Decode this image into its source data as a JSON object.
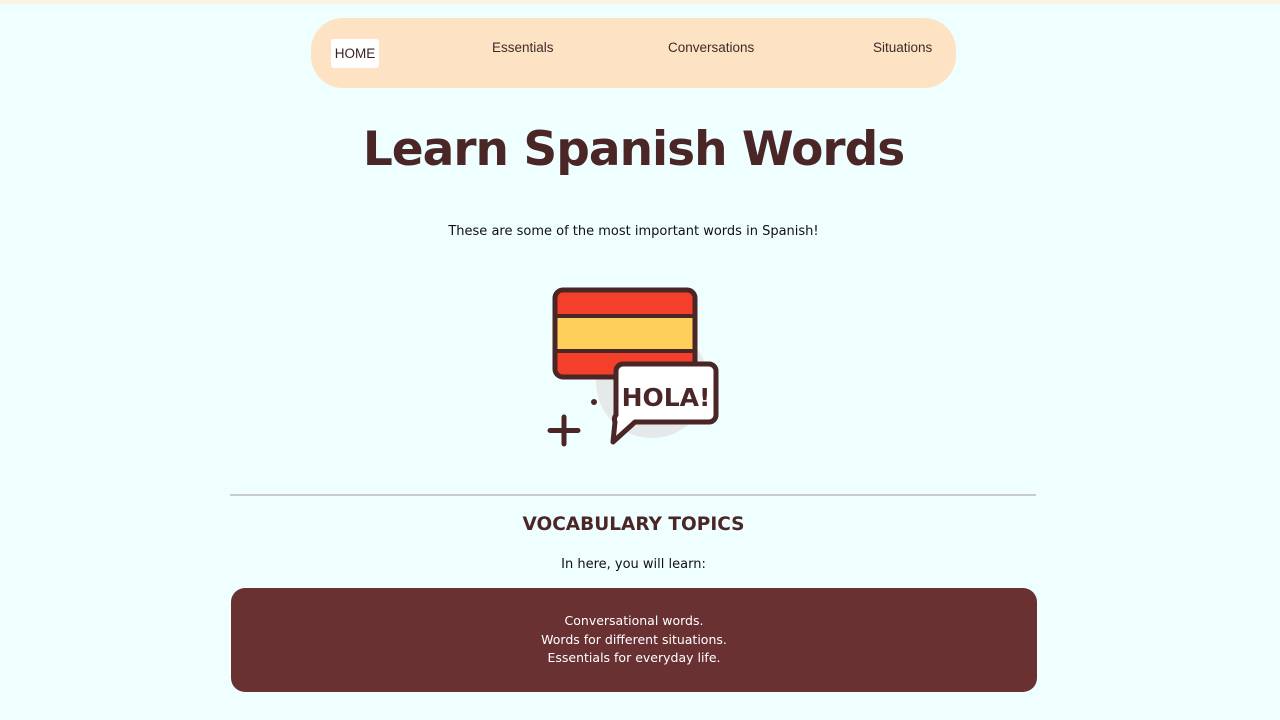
{
  "nav": {
    "items": [
      {
        "label": "HOME"
      },
      {
        "label": "Essentials"
      },
      {
        "label": "Conversations"
      },
      {
        "label": "Situations"
      }
    ]
  },
  "hero": {
    "title": "Learn Spanish Words",
    "subtitle": "These are some of the most important words in Spanish!",
    "illustration": {
      "icon": "spanish-flag-hola-speech-bubble-icon",
      "bubble_text": "HOLA!",
      "colors": {
        "flag_red": "#f43f2b",
        "flag_yellow": "#ffcf5c",
        "outline": "#4a2726",
        "bubble_fill": "#ffffff",
        "backdrop": "#e6e9ea"
      }
    }
  },
  "vocab": {
    "title": "VOCABULARY TOPICS",
    "intro": "In here, you will learn:",
    "items": [
      "Conversational words.",
      "Words for different situations.",
      "Essentials for everyday life."
    ]
  },
  "colors": {
    "page_bg": "#effefe",
    "nav_bg": "#fde2c4",
    "heading": "#4a2726",
    "topics_box": "#6a3133"
  }
}
